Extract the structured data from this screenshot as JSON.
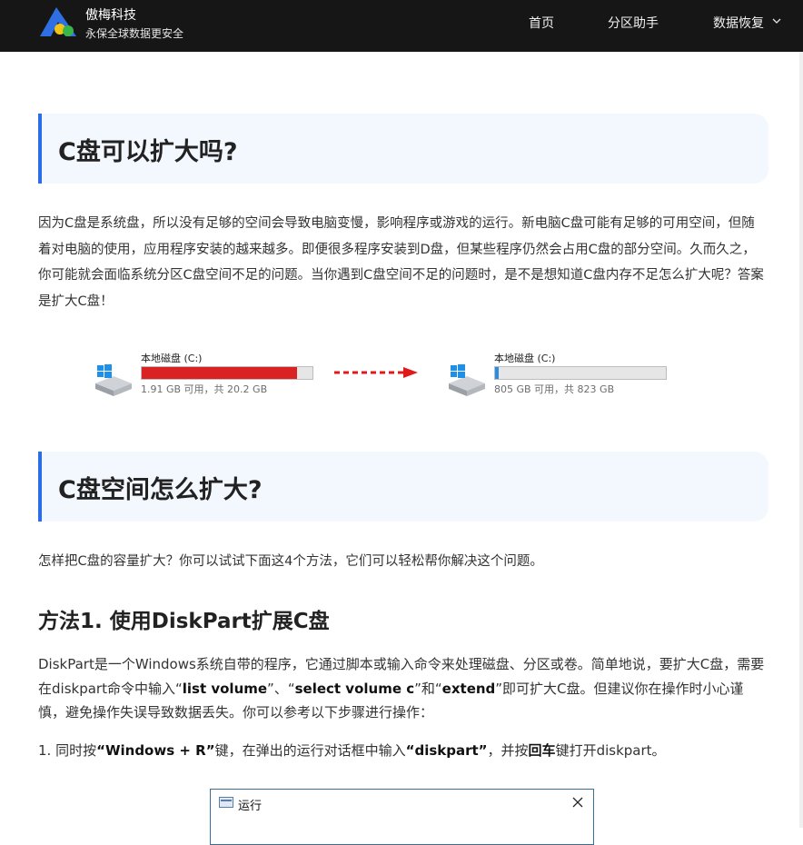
{
  "header": {
    "brand_name": "傲梅科技",
    "slogan": "永保全球数据更安全",
    "nav": [
      {
        "label": "首页"
      },
      {
        "label": "分区助手"
      },
      {
        "label": "数据恢复"
      }
    ]
  },
  "sections": [
    {
      "heading": "C盘可以扩大吗?"
    },
    {
      "heading": "C盘空间怎么扩大?"
    }
  ],
  "intro_paragraph": "因为C盘是系统盘，所以没有足够的空间会导致电脑变慢，影响程序或游戏的运行。新电脑C盘可能有足够的可用空间，但随着对电脑的使用，应用程序安装的越来越多。即便很多程序安装到D盘，但某些程序仍然会占用C盘的部分空间。久而久之，你可能就会面临系统分区C盘空间不足的问题。当你遇到C盘空间不足的问题时，是不是想知道C盘内存不足怎么扩大呢？答案是扩大C盘！",
  "illustration": {
    "before": {
      "label": "本地磁盘 (C:)",
      "size_text": "1.91 GB 可用，共 20.2 GB",
      "used_fraction": 0.91,
      "fill_color": "#da2222"
    },
    "after": {
      "label": "本地磁盘 (C:)",
      "size_text": "805 GB 可用，共 823 GB",
      "used_fraction": 0.02,
      "fill_color": "#2a8de2"
    },
    "arrow_color": "#e01a1a"
  },
  "section2_paragraph": "怎样把C盘的容量扩大？你可以试试下面这4个方法，它们可以轻松帮你解决这个问题。",
  "method1": {
    "title": "方法1. 使用DiskPart扩展C盘",
    "desc_part1": "DiskPart是一个Windows系统自带的程序，它通过脚本或输入命令来处理磁盘、分区或卷。简单地说，要扩大C盘，需要在diskpart命令中输入“",
    "cmd1": "list volume",
    "desc_part2": "”、“",
    "cmd2": "select volume c",
    "desc_part3": "”和“",
    "cmd3": "extend",
    "desc_part4": "”即可扩大C盘。但建议你在操作时小心谨慎，避免操作失误导致数据丢失。你可以参考以下步骤进行操作：",
    "step1_prefix": "1. 同时按",
    "step1_key": "“Windows + R”",
    "step1_mid": "键，在弹出的运行对话框中输入",
    "step1_cmd": "“diskpart”",
    "step1_mid2": "，并按",
    "step1_enter": "回车",
    "step1_suffix": "键打开diskpart。"
  },
  "run_dialog": {
    "title": "运行"
  },
  "colors": {
    "accent": "#2b6de6",
    "header_bg": "#161616",
    "heading_bg": "#f3f7fe"
  }
}
